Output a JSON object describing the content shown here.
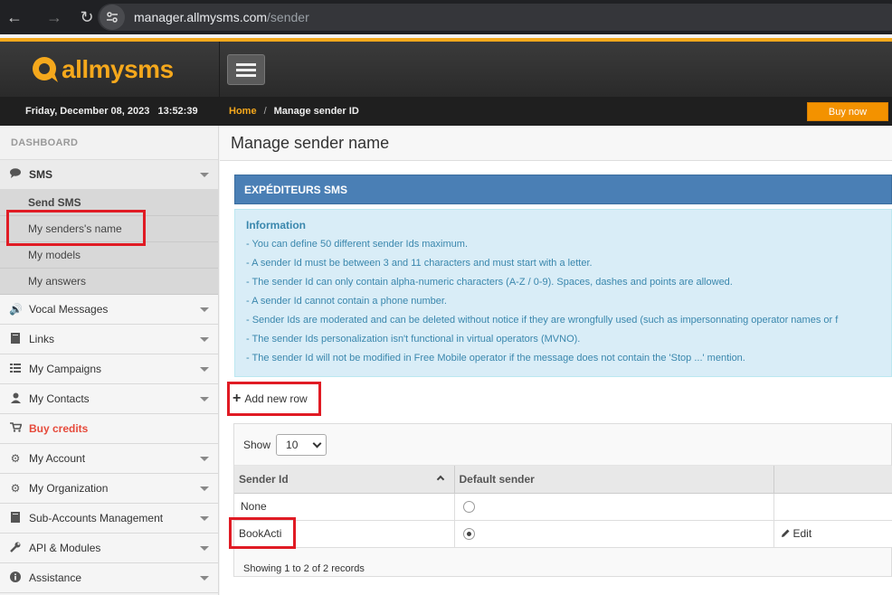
{
  "browser": {
    "url_host": "manager.allmysms.com",
    "url_path": "/sender"
  },
  "header": {
    "logo_text": "allmysms",
    "datetime": "Friday, December 08, 2023   13:52:39",
    "breadcrumb_home": "Home",
    "breadcrumb_sep": "/",
    "breadcrumb_current": "Manage sender ID",
    "buy_now": "Buy now"
  },
  "sidebar": {
    "dashboard": "DASHBOARD",
    "sms": "SMS",
    "sms_sub": [
      "Send SMS",
      "My senders's name",
      "My models",
      "My answers"
    ],
    "items": [
      {
        "label": "Vocal Messages",
        "icon": "speaker-icon"
      },
      {
        "label": "Links",
        "icon": "book-icon"
      },
      {
        "label": "My Campaigns",
        "icon": "list-icon"
      },
      {
        "label": "My Contacts",
        "icon": "user-icon"
      },
      {
        "label": "Buy credits",
        "icon": "cart-icon"
      },
      {
        "label": "My Account",
        "icon": "gear-icon"
      },
      {
        "label": "My Organization",
        "icon": "gear-icon"
      },
      {
        "label": "Sub-Accounts Management",
        "icon": "book-icon"
      },
      {
        "label": "API & Modules",
        "icon": "wrench-icon"
      },
      {
        "label": "Assistance",
        "icon": "info-icon"
      }
    ]
  },
  "main": {
    "page_title": "Manage sender name",
    "panel_title": "EXPÉDITEURS SMS",
    "info_title": "Information",
    "info_lines": [
      "- You can define 50 different sender Ids maximum.",
      "- A sender Id must be between 3 and 11 characters and must start with a letter.",
      "- The sender Id can only contain alpha-numeric characters (A-Z / 0-9). Spaces, dashes and points are allowed.",
      "- A sender Id cannot contain a phone number.",
      "- Sender Ids are moderated and can be deleted without notice if they are wrongfully used (such as impersonnating operator names or f",
      "- The sender Ids personalization isn't functional in virtual operators (MVNO).",
      "- The sender Id will not be modified in Free Mobile operator if the message does not contain the 'Stop ...' mention."
    ],
    "add_row": "Add new row",
    "show_label": "Show",
    "page_size": "10",
    "columns": [
      "Sender Id",
      "Default sender",
      ""
    ],
    "rows": [
      {
        "sender": "None",
        "default": false,
        "action": ""
      },
      {
        "sender": "BookActi",
        "default": true,
        "action": "Edit"
      }
    ],
    "footer": "Showing 1 to 2 of 2 records"
  }
}
